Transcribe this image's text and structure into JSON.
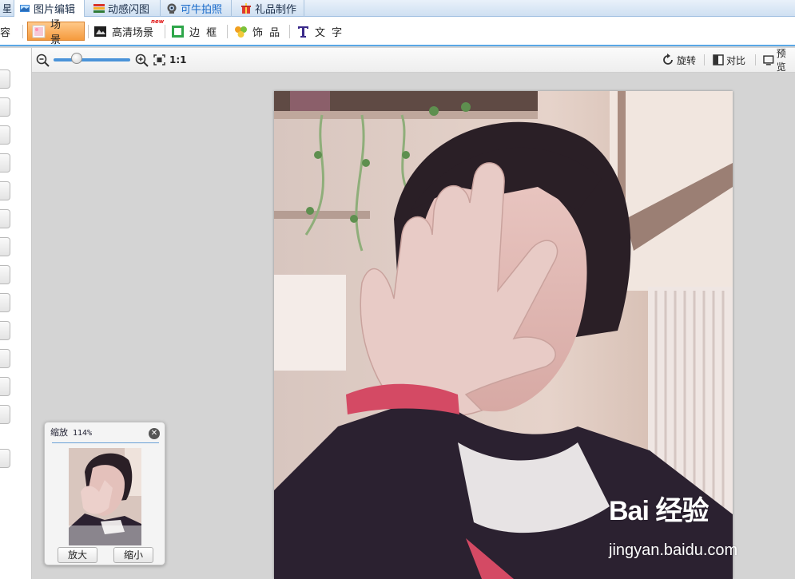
{
  "tabs": [
    {
      "label": "图片编辑",
      "icon": "photo-edit-icon"
    },
    {
      "label": "动感闪图",
      "icon": "flash-image-icon"
    },
    {
      "label": "可牛拍照",
      "icon": "webcam-icon"
    },
    {
      "label": "礼品制作",
      "icon": "gift-icon"
    }
  ],
  "tab_partial_left": "星",
  "toolbar": {
    "partial_left": "容",
    "items": [
      {
        "label": "场 景",
        "icon": "scene-icon",
        "selected": true
      },
      {
        "label": "高清场景",
        "icon": "hd-scene-icon",
        "badge": "new"
      },
      {
        "label": "边 框",
        "icon": "frame-icon"
      },
      {
        "label": "饰 品",
        "icon": "decoration-icon"
      },
      {
        "label": "文 字",
        "icon": "text-icon"
      }
    ]
  },
  "zoombar": {
    "ratio_label": "1:1",
    "rotate_label": "旋转",
    "compare_label": "对比",
    "preview_label": "预览",
    "slider_value": 0.3
  },
  "navigator": {
    "title": "缩放",
    "zoom_text": "114%",
    "zoom_in_label": "放大",
    "zoom_out_label": "缩小"
  },
  "watermark": {
    "logo": "Bai 经验",
    "url": "jingyan.baidu.com"
  },
  "colors": {
    "accent_blue": "#5aa7e6",
    "selected_orange": "#f59a3d",
    "tab_bar": "#cfe0f2"
  }
}
